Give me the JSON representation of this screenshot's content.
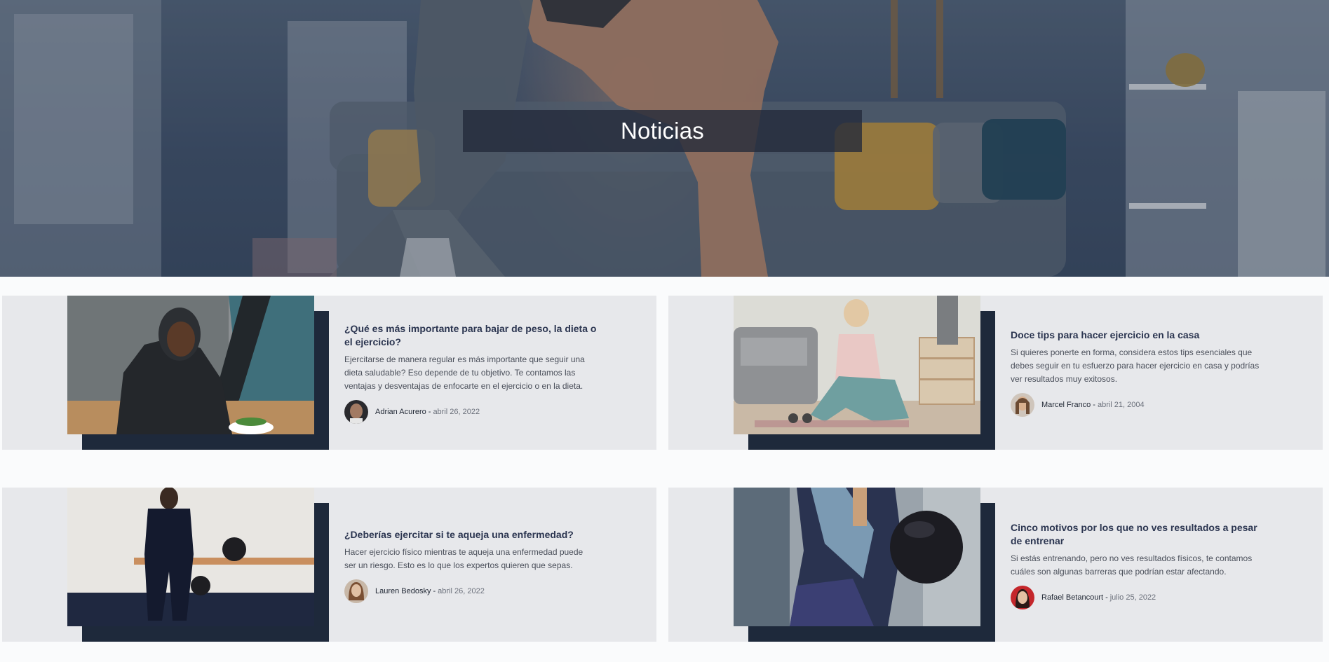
{
  "hero": {
    "title": "Noticias"
  },
  "articles": [
    {
      "title": "¿Qué es más importante para bajar de peso, la dieta o el ejercicio?",
      "excerpt": "Ejercitarse de manera regular es más importante que seguir una dieta saludable? Eso depende de tu objetivo. Te contamos las ventajas y desventajas de enfocarte en el ejercicio o en la dieta.",
      "author": "Adrian Acurero",
      "separator": "-",
      "date": "abril 26, 2022"
    },
    {
      "title": "Doce tips para hacer ejercicio en la casa",
      "excerpt": "Si quieres ponerte en forma, considera estos tips esenciales que debes seguir en tu esfuerzo para hacer ejercicio en casa y podrías ver resultados muy exitosos.",
      "author": "Marcel Franco",
      "separator": "-",
      "date": "abril 21, 2004"
    },
    {
      "title": "¿Deberías ejercitar si te aqueja una enfermedad?",
      "excerpt": "Hacer ejercicio físico mientras te aqueja una enfermedad puede ser un riesgo. Esto es lo que los expertos quieren que sepas.",
      "author": "Lauren Bedosky",
      "separator": "-",
      "date": "abril 26, 2022"
    },
    {
      "title": "Cinco motivos por los que no ves resultados a pesar de entrenar",
      "excerpt": "Si estás entrenando, pero no ves resultados físicos, te contamos cuáles son algunas barreras que podrían estar afectando.",
      "author": "Rafael Betancourt",
      "separator": "-",
      "date": "julio 25, 2022"
    }
  ],
  "colors": {
    "card_background": "#e7e8eb",
    "accent_block": "#1e293b",
    "title_text": "#2b3550",
    "hero_overlay": "#22293a"
  }
}
